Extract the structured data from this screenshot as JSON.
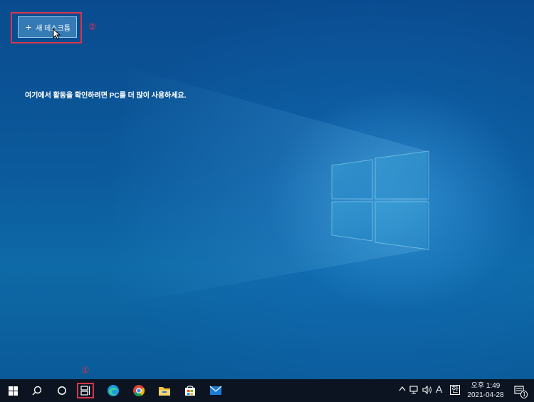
{
  "desktop": {
    "new_desktop_label": "새 데스크톱",
    "activity_message": "여기에서 활동을 확인하려면 PC를 더 많이 사용하세요."
  },
  "annotations": {
    "step1": "①",
    "step2": "②"
  },
  "taskbar": {
    "icons": [
      "windows-start-icon",
      "search-icon",
      "cortana-icon",
      "task-view-icon",
      "edge-icon",
      "chrome-icon",
      "file-explorer-icon",
      "store-icon",
      "mail-icon"
    ],
    "tray": {
      "ime_label": "A",
      "ime_mode": "한",
      "time": "오후 1:49",
      "date": "2021-04-28",
      "notification_count": "1"
    }
  },
  "colors": {
    "annotation": "#e0304a",
    "taskbar": "#0b1420"
  }
}
